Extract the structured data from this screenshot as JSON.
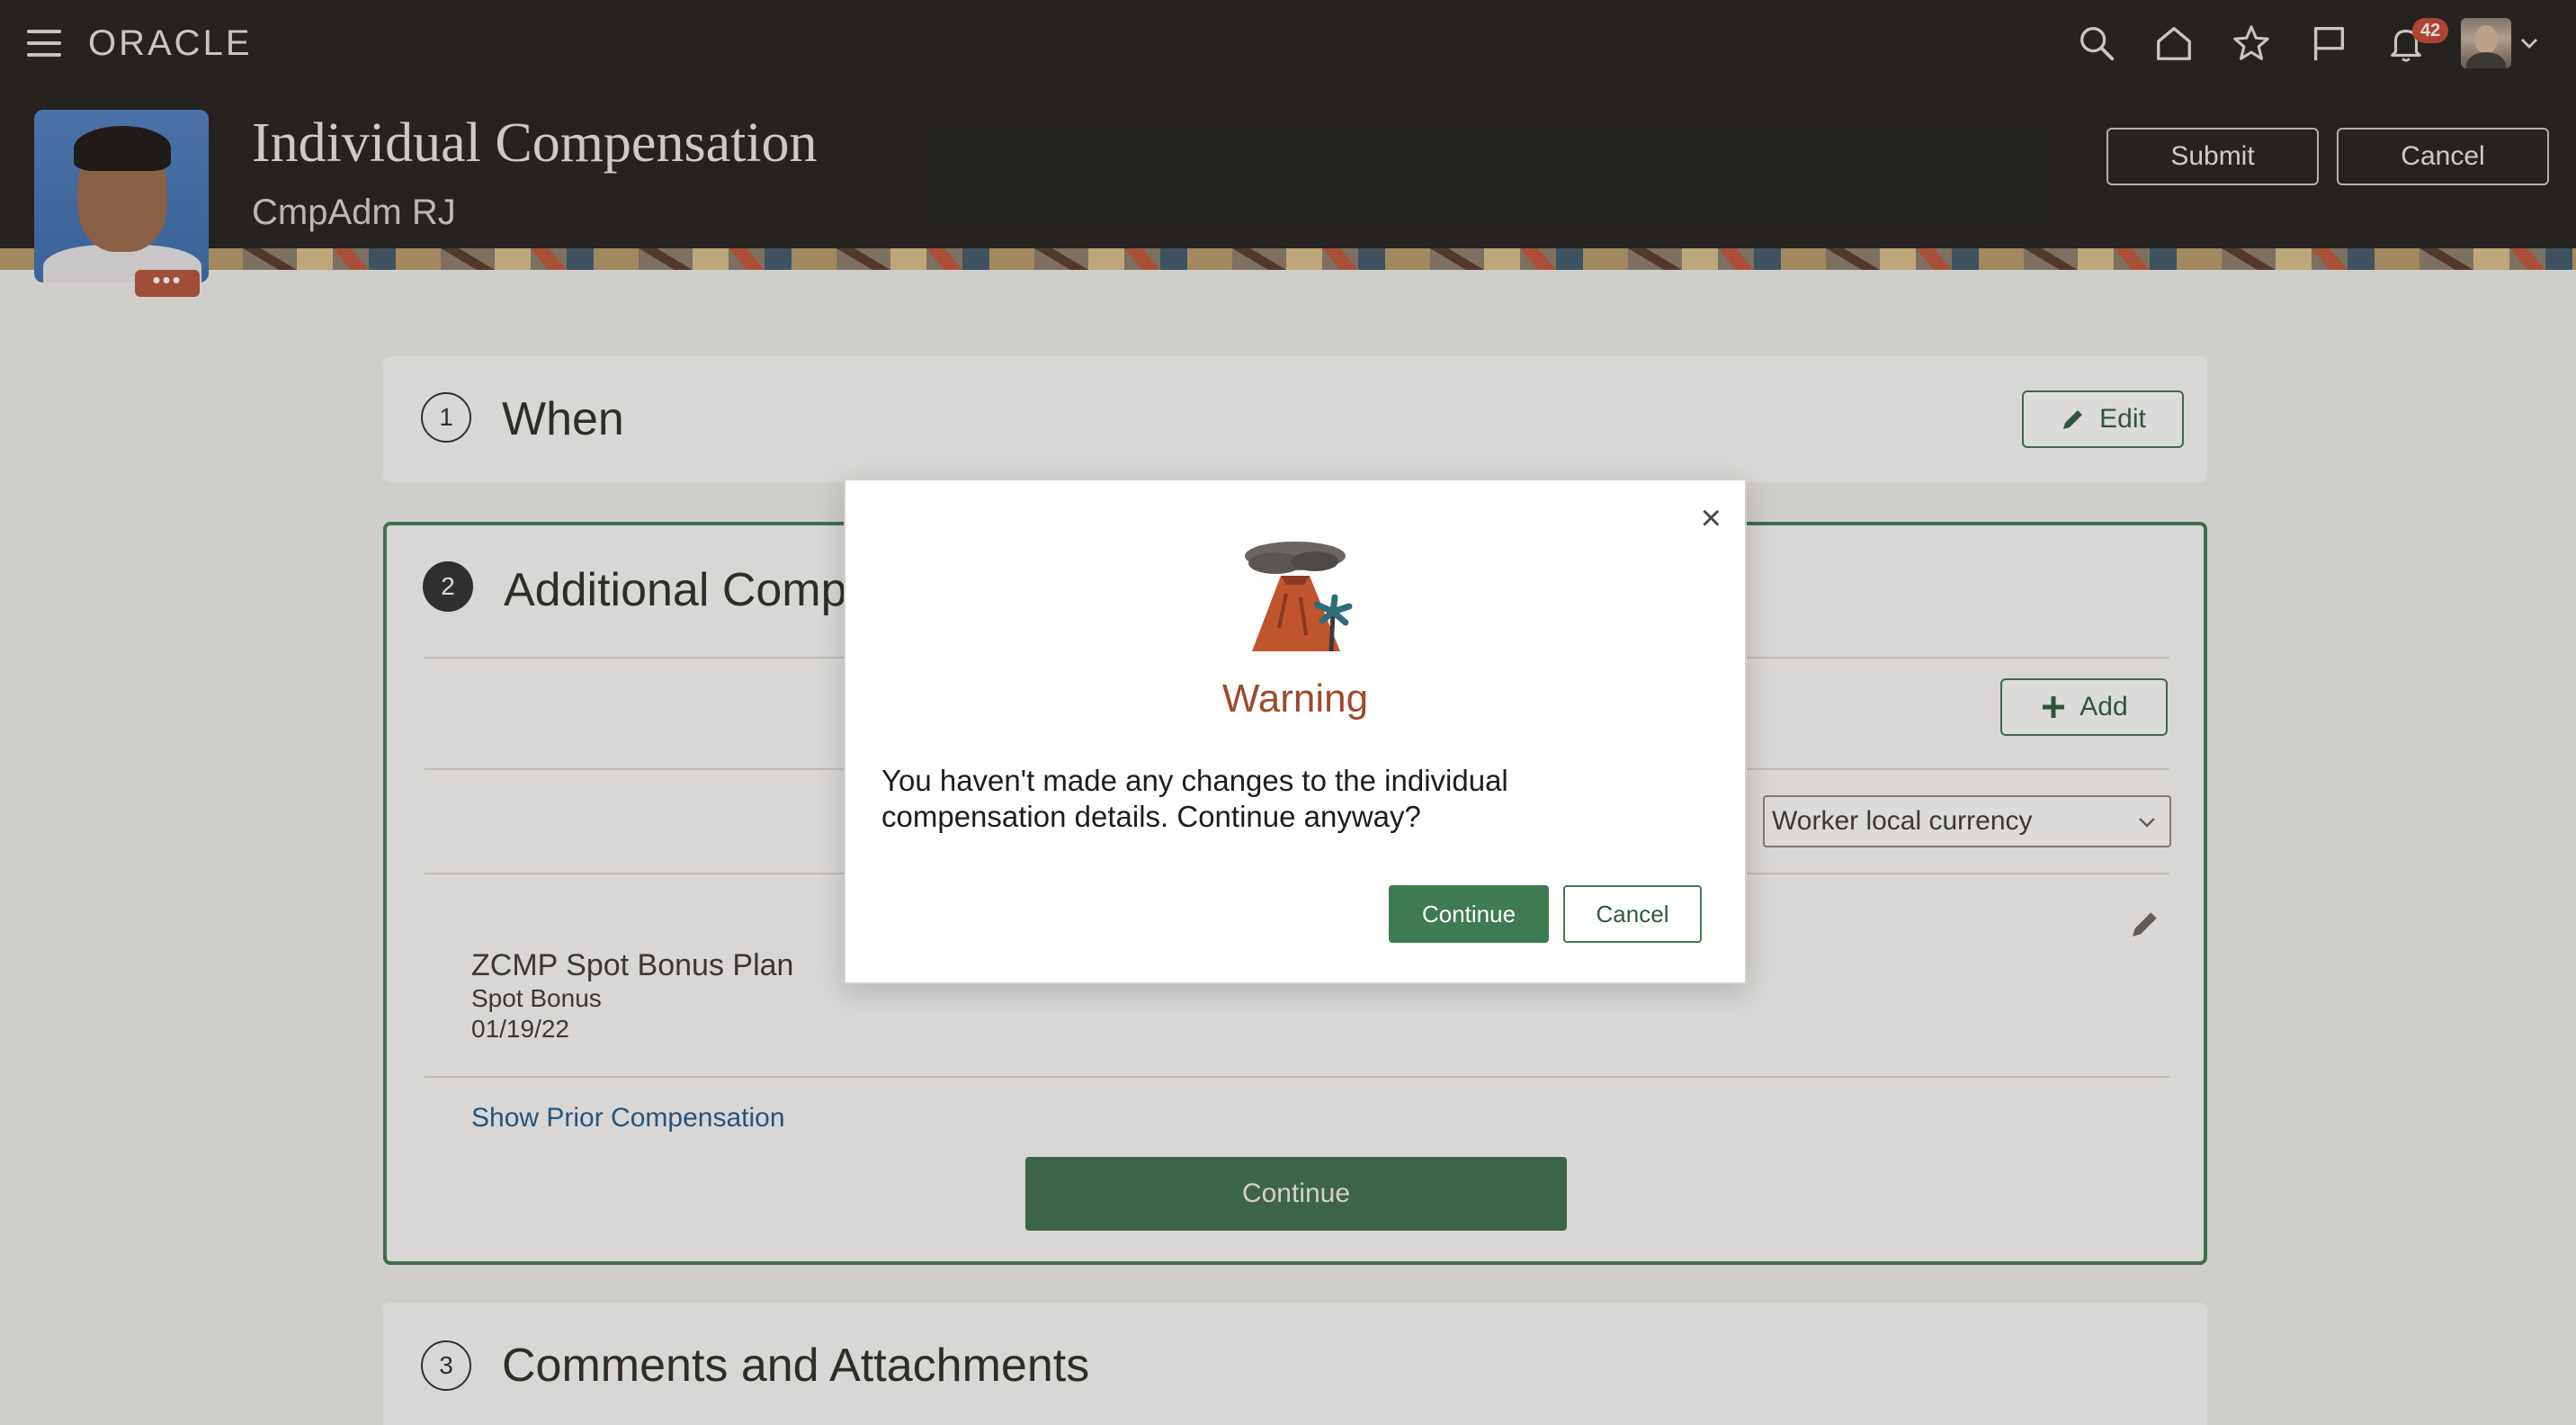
{
  "topbar": {
    "brand": "ORACLE",
    "notifications_count": "42",
    "icons": [
      "menu-icon",
      "search-icon",
      "home-icon",
      "star-icon",
      "flag-icon",
      "bell-icon",
      "user-avatar",
      "chevron-down-icon"
    ]
  },
  "header": {
    "title": "Individual Compensation",
    "subtitle": "CmpAdm RJ",
    "submit_label": "Submit",
    "cancel_label": "Cancel",
    "photo_more": "•••"
  },
  "steps": {
    "when": {
      "number": "1",
      "title": "When",
      "edit_label": "Edit"
    },
    "additional": {
      "number": "2",
      "title": "Additional Compe",
      "add_label": "Add",
      "currency_select": "Worker local currency",
      "plan": {
        "name": "ZCMP Spot Bonus Plan",
        "type": "Spot Bonus",
        "date": "01/19/22"
      },
      "show_prior_label": "Show Prior Compensation",
      "continue_label": "Continue"
    },
    "comments": {
      "number": "3",
      "title": "Comments and Attachments"
    }
  },
  "dialog": {
    "title": "Warning",
    "message": "You haven't made any changes to the individual compensation details. Continue anyway?",
    "continue_label": "Continue",
    "cancel_label": "Cancel",
    "close_symbol": "×"
  },
  "colors": {
    "topbar_bg": "#201e1c",
    "accent_green": "#3f7a53",
    "warning_brown": "#9e4a2c",
    "badge_red": "#c74634",
    "link_blue": "#1f5c8c"
  }
}
